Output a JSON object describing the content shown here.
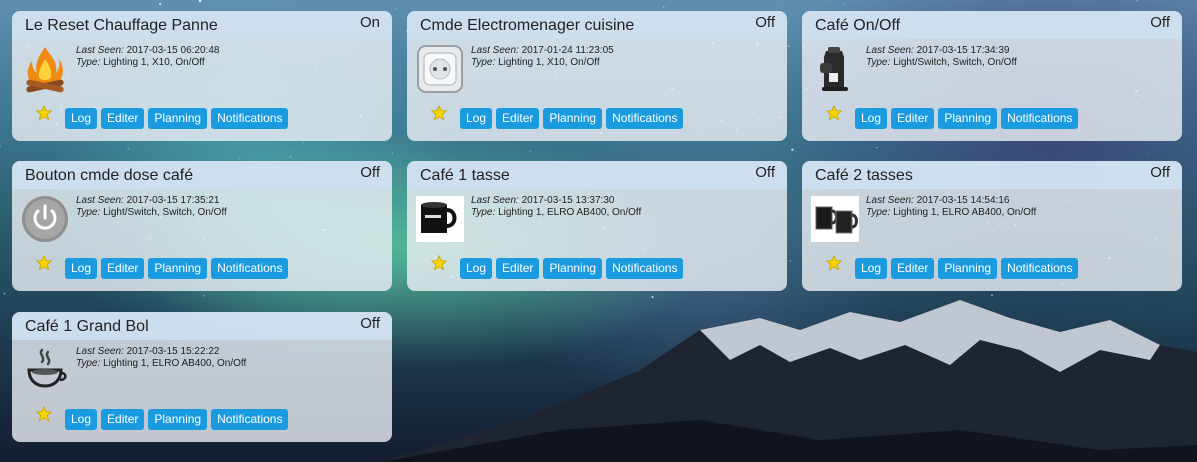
{
  "labels": {
    "last_seen": "Last Seen:",
    "type": "Type:"
  },
  "buttons": {
    "log": "Log",
    "edit": "Editer",
    "planning": "Planning",
    "notifications": "Notifications"
  },
  "devices": [
    {
      "name": "Le Reset Chauffage Panne",
      "status": "On",
      "last_seen": "2017-03-15 06:20:48",
      "type": "Lighting 1, X10, On/Off",
      "icon": "fire-icon"
    },
    {
      "name": "Cmde Electromenager cuisine",
      "status": "Off",
      "last_seen": "2017-01-24 11:23:05",
      "type": "Lighting 1, X10, On/Off",
      "icon": "wall-socket-icon"
    },
    {
      "name": "Café On/Off",
      "status": "Off",
      "last_seen": "2017-03-15 17:34:39",
      "type": "Light/Switch, Switch, On/Off",
      "icon": "coffee-machine-icon"
    },
    {
      "name": "Bouton cmde dose café",
      "status": "Off",
      "last_seen": "2017-03-15 17:35:21",
      "type": "Light/Switch, Switch, On/Off",
      "icon": "power-button-icon"
    },
    {
      "name": "Café 1 tasse",
      "status": "Off",
      "last_seen": "2017-03-15 13:37:30",
      "type": "Lighting 1, ELRO AB400, On/Off",
      "icon": "cup-icon"
    },
    {
      "name": "Café 2 tasses",
      "status": "Off",
      "last_seen": "2017-03-15 14:54:16",
      "type": "Lighting 1, ELRO AB400, On/Off",
      "icon": "two-cups-icon"
    },
    {
      "name": "Café 1 Grand Bol",
      "status": "Off",
      "last_seen": "2017-03-15 15:22:22",
      "type": "Lighting 1, ELRO AB400, On/Off",
      "icon": "steaming-bowl-icon"
    }
  ],
  "colors": {
    "button": "#1a9be0",
    "card_header": "#cddef0",
    "star": "#f5d400"
  }
}
